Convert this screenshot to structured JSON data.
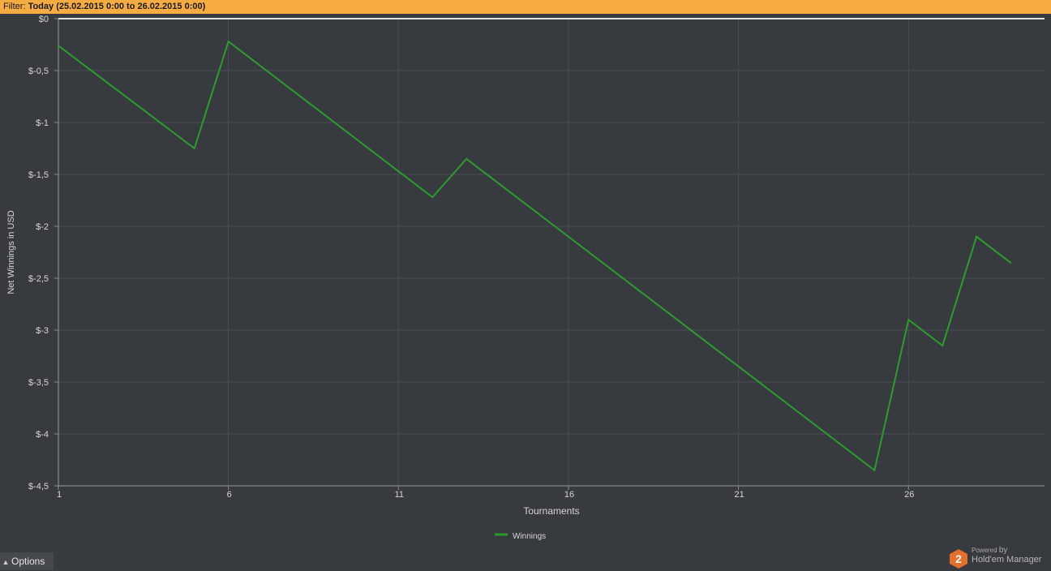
{
  "filter": {
    "label": "Filter:",
    "value": "Today (25.02.2015 0:00 to 26.02.2015 0:00)"
  },
  "chart_data": {
    "type": "line",
    "xlabel": "Tournaments",
    "ylabel": "Net Winnings in USD",
    "xlim": [
      1,
      30
    ],
    "ylim": [
      -4.5,
      0
    ],
    "x_ticks": [
      1,
      6,
      11,
      16,
      21,
      26
    ],
    "y_ticks": [
      0,
      -0.5,
      -1,
      -1.5,
      -2,
      -2.5,
      -3,
      -3.5,
      -4,
      -4.5
    ],
    "y_tick_labels": [
      "$0",
      "$-0,5",
      "$-1",
      "$-1,5",
      "$-2",
      "$-2,5",
      "$-3",
      "$-3,5",
      "$-4",
      "$-4,5"
    ],
    "grid": true,
    "legend_position": "bottom-center",
    "series": [
      {
        "name": "Winnings",
        "color": "#2e9b2e",
        "x": [
          1,
          5,
          6,
          12,
          13,
          25,
          26,
          27,
          28,
          29
        ],
        "y": [
          -0.26,
          -1.25,
          -0.22,
          -1.72,
          -1.35,
          -4.35,
          -2.9,
          -3.15,
          -2.1,
          -2.35
        ]
      }
    ]
  },
  "options": {
    "label": "Options",
    "icon": "chevron-up-icon"
  },
  "branding": {
    "powered": "Powered",
    "by": "by",
    "name": "Hold'em Manager",
    "badge": "2",
    "badge_color": "#e2702c"
  }
}
